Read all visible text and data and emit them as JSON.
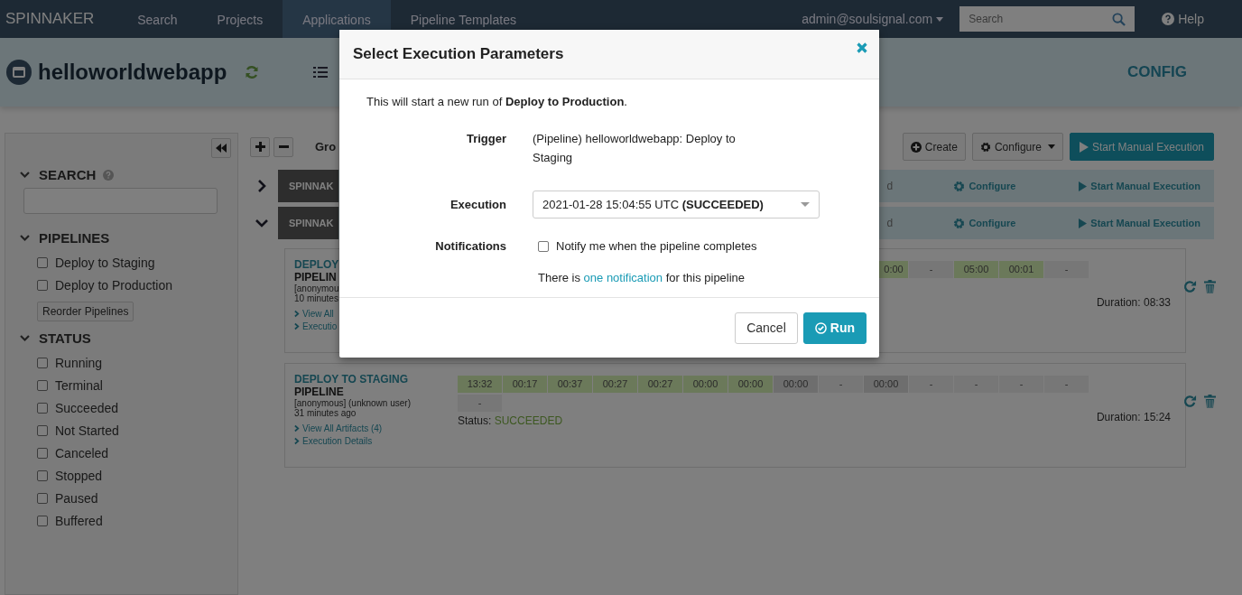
{
  "top_nav": {
    "brand": "SPINNAKER",
    "items": [
      {
        "label": "Search",
        "selected": false
      },
      {
        "label": "Projects",
        "selected": false
      },
      {
        "label": "Applications",
        "selected": true
      },
      {
        "label": "Pipeline Templates",
        "selected": false
      }
    ],
    "user": "admin@soulsignal.com",
    "search": {
      "placeholder": "Search"
    },
    "help": "Help"
  },
  "app_header": {
    "name": "helloworldwebapp",
    "config": "CONFIG"
  },
  "sidebar": {
    "search_title": "SEARCH",
    "pipelines_title": "PIPELINES",
    "pipelines": [
      {
        "label": "Deploy to Staging",
        "checked": false
      },
      {
        "label": "Deploy to Production",
        "checked": false
      }
    ],
    "reorder": "Reorder Pipelines",
    "status_title": "STATUS",
    "statuses": [
      {
        "label": "Running",
        "checked": false
      },
      {
        "label": "Terminal",
        "checked": false
      },
      {
        "label": "Succeeded",
        "checked": false
      },
      {
        "label": "Not Started",
        "checked": false
      },
      {
        "label": "Canceled",
        "checked": false
      },
      {
        "label": "Stopped",
        "checked": false
      },
      {
        "label": "Paused",
        "checked": false
      },
      {
        "label": "Buffered",
        "checked": false
      }
    ]
  },
  "toolbar": {
    "group_label": "Gro",
    "create": "Create",
    "configure": "Configure",
    "start": "Start Manual Execution"
  },
  "groups": [
    {
      "name": "SPINNAK",
      "expanded": false,
      "status_fragment": "d",
      "configure": "Configure",
      "start": "Start Manual Execution"
    },
    {
      "name": "SPINNAK",
      "expanded": true,
      "status_fragment": "d",
      "configure": "Configure",
      "start": "Start Manual Execution"
    }
  ],
  "executions": [
    {
      "title": "DEPLOY",
      "type": "PIPELIN",
      "trigger": "[anonymou",
      "time": "10 minutes",
      "links": [
        "View All",
        "Executio"
      ],
      "stages_cut": true,
      "stages": [
        {
          "label": "0:00",
          "kind": "succeeded"
        },
        {
          "label": "-",
          "kind": "not_started"
        },
        {
          "label": "05:00",
          "kind": "succeeded"
        },
        {
          "label": "00:01",
          "kind": "succeeded"
        },
        {
          "label": "-",
          "kind": "not_started"
        }
      ],
      "duration": "Duration: 08:33"
    },
    {
      "title": "DEPLOY TO STAGING",
      "type": "PIPELINE",
      "trigger": "[anonymous] (unknown user)",
      "time": "31 minutes ago",
      "links": [
        "View All Artifacts (4)",
        "Execution Details"
      ],
      "stages_cut": false,
      "stages": [
        {
          "label": "13:32",
          "kind": "succeeded"
        },
        {
          "label": "00:17",
          "kind": "succeeded"
        },
        {
          "label": "00:37",
          "kind": "succeeded"
        },
        {
          "label": "00:27",
          "kind": "succeeded"
        },
        {
          "label": "00:27",
          "kind": "succeeded"
        },
        {
          "label": "00:00",
          "kind": "succeeded"
        },
        {
          "label": "00:00",
          "kind": "succeeded"
        },
        {
          "label": "00:00",
          "kind": "skipped"
        },
        {
          "label": "-",
          "kind": "not_started"
        },
        {
          "label": "00:00",
          "kind": "skipped"
        },
        {
          "label": "-",
          "kind": "not_started"
        },
        {
          "label": "-",
          "kind": "not_started"
        },
        {
          "label": "-",
          "kind": "not_started"
        },
        {
          "label": "-",
          "kind": "not_started"
        },
        {
          "label": "-",
          "kind": "not_started"
        }
      ],
      "status_label": "Status:",
      "status": "SUCCEEDED",
      "duration": "Duration: 15:24"
    }
  ],
  "modal": {
    "title": "Select Execution Parameters",
    "intro": "This will start a new run of **Deploy to Production**.",
    "fields": [
      {
        "label": "Trigger",
        "kind": "text",
        "value": "(Pipeline) helloworldwebapp: Deploy to Staging"
      },
      {
        "label": "Execution",
        "kind": "select",
        "value": "2021-01-28 15:04:55 UTC **(SUCCEEDED)**"
      },
      {
        "label": "Notifications",
        "kind": "checkbox",
        "option": "Notify me when the pipeline completes",
        "checked": false,
        "note_before": "There is ",
        "note_link": "one notification",
        "note_after": " for this pipeline"
      }
    ],
    "buttons": [
      {
        "label": "Cancel",
        "kind": "secondary"
      },
      {
        "label": "Run",
        "kind": "primary"
      }
    ]
  }
}
